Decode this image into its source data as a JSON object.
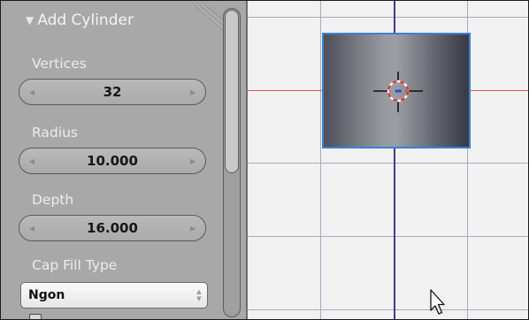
{
  "panel": {
    "title": "Add Cylinder",
    "vertices": {
      "label": "Vertices",
      "value": "32"
    },
    "radius": {
      "label": "Radius",
      "value": "10.000"
    },
    "depth": {
      "label": "Depth",
      "value": "16.000"
    },
    "cap_fill_type": {
      "label": "Cap Fill Type",
      "value": "Ngon"
    }
  },
  "icons": {
    "collapse": "triangle-down-icon",
    "stepper_left": "arrow-left-icon",
    "stepper_right": "arrow-right-icon",
    "select": "up-down-icon",
    "cursor_3d": "crosshair-icon",
    "mouse": "mouse-pointer-icon"
  },
  "colors": {
    "panel_bg": "#a8a8a8",
    "viewport_bg": "#f1f1f1",
    "grid": "#a9a9c4",
    "x_axis": "#d65a48",
    "y_axis": "#3c3c90",
    "selection_outline": "#3b82d4"
  }
}
